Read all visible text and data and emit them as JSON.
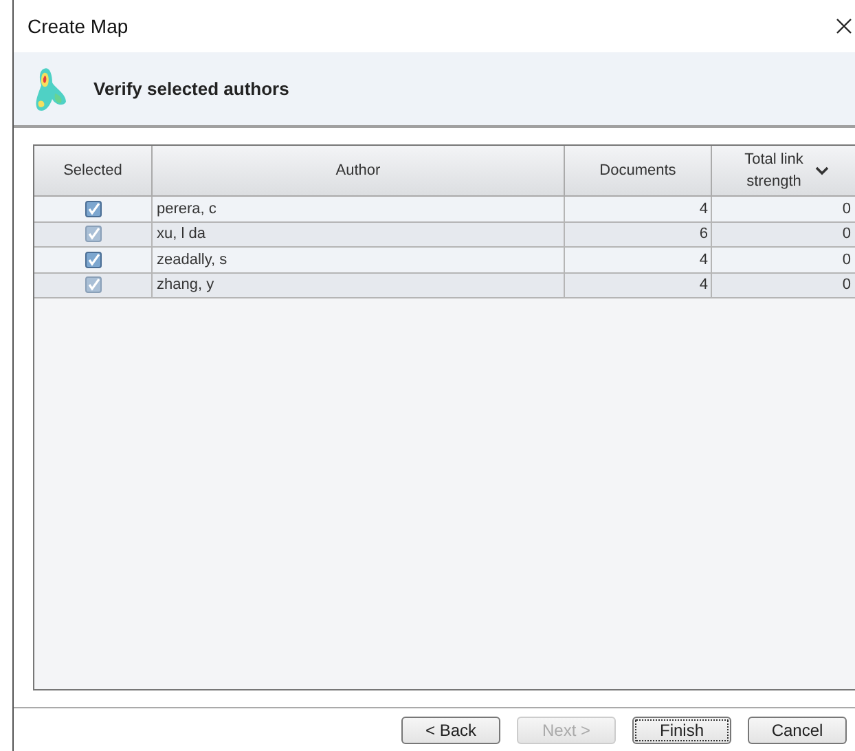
{
  "window": {
    "title": "Create Map"
  },
  "header": {
    "title": "Verify selected authors"
  },
  "table": {
    "columns": [
      "Selected",
      "Author",
      "Documents",
      "Total link strength"
    ],
    "rows": [
      {
        "checked": true,
        "author": "perera, c",
        "documents": "4",
        "total_link_strength": "0"
      },
      {
        "checked": true,
        "author": "xu, l da",
        "documents": "6",
        "total_link_strength": "0"
      },
      {
        "checked": true,
        "author": "zeadally, s",
        "documents": "4",
        "total_link_strength": "0"
      },
      {
        "checked": true,
        "author": "zhang, y",
        "documents": "4",
        "total_link_strength": "0"
      }
    ]
  },
  "buttons": [
    {
      "label": "< Back",
      "disabled": false,
      "focused": false
    },
    {
      "label": "Next >",
      "disabled": true,
      "focused": false
    },
    {
      "label": "Finish",
      "disabled": false,
      "focused": true
    },
    {
      "label": "Cancel",
      "disabled": false,
      "focused": false
    }
  ]
}
